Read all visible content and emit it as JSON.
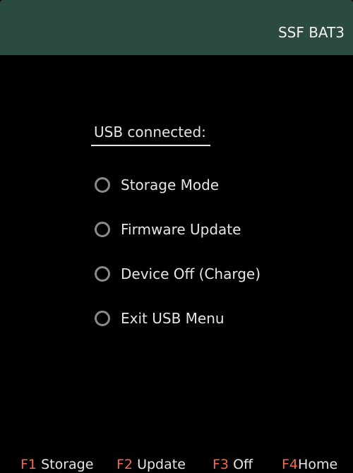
{
  "header": {
    "device_name": "SSF BAT3"
  },
  "menu": {
    "title": "USB connected:",
    "options": [
      {
        "label": "Storage Mode",
        "selected": false
      },
      {
        "label": "Firmware Update",
        "selected": false
      },
      {
        "label": "Device Off (Charge)",
        "selected": false
      },
      {
        "label": "Exit USB Menu",
        "selected": false
      }
    ]
  },
  "softkeys": [
    {
      "key": "F1",
      "label": "Storage"
    },
    {
      "key": "F2",
      "label": "Update"
    },
    {
      "key": "F3",
      "label": "Off"
    },
    {
      "key": "F4",
      "label": "Home"
    }
  ],
  "colors": {
    "header_bg": "#2b4a41",
    "screen_bg": "#000000",
    "softkey_accent": "#f26a4f",
    "radio_ring": "#8a8a8a"
  }
}
